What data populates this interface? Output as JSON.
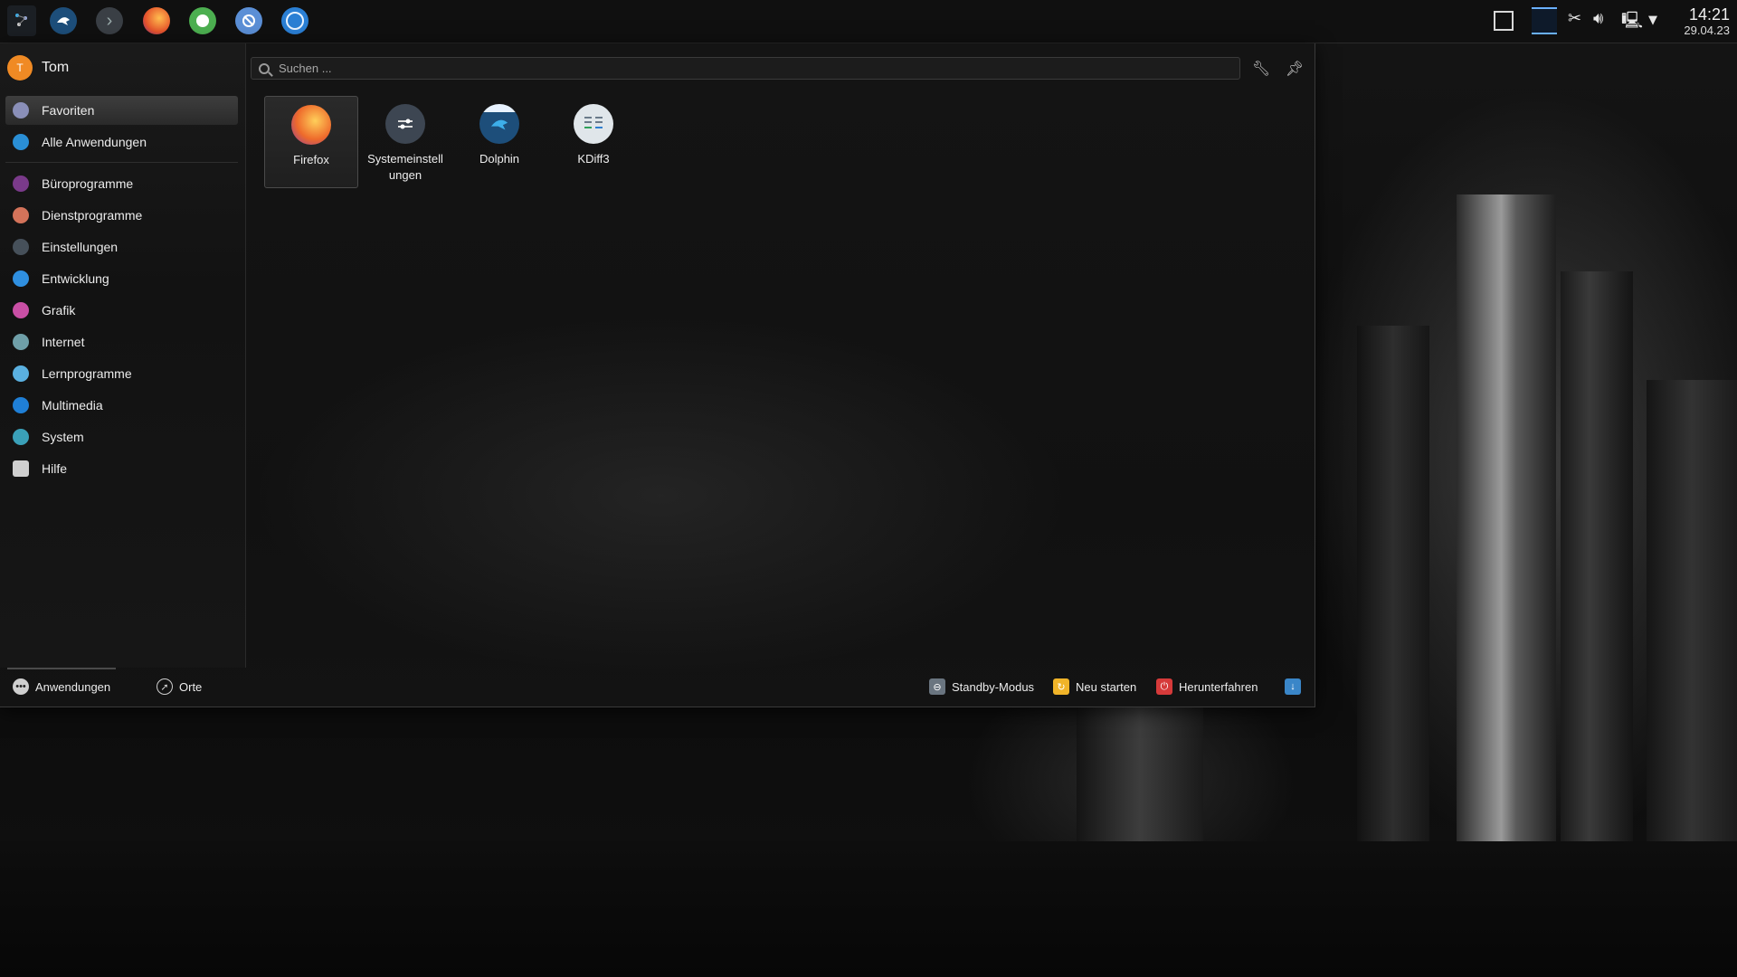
{
  "taskbar": {
    "icons": [
      "kde-launcher-icon",
      "dolphin-icon",
      "chevron-right-icon",
      "firefox-icon",
      "download-icon",
      "krdc-icon",
      "circle-app-icon"
    ],
    "tray": [
      "window-icon",
      "desktop-pager-icon",
      "scissors-icon",
      "volume-icon",
      "network-icon",
      "expand-arrow-icon"
    ],
    "clock": {
      "time": "14:21",
      "date": "29.04.23"
    }
  },
  "user": {
    "initial": "T",
    "name": "Tom"
  },
  "sidebar": {
    "items": [
      {
        "label": "Favoriten",
        "icon": "favorites-icon",
        "color": "#8a8fb8",
        "active": true
      },
      {
        "label": "Alle Anwendungen",
        "icon": "all-apps-icon",
        "color": "#2a8fd6"
      },
      {
        "label": "Büroprogramme",
        "icon": "office-icon",
        "color": "#7a3a8a"
      },
      {
        "label": "Dienstprogramme",
        "icon": "utilities-icon",
        "color": "#d4735a"
      },
      {
        "label": "Einstellungen",
        "icon": "settings-icon",
        "color": "#46505a"
      },
      {
        "label": "Entwicklung",
        "icon": "development-icon",
        "color": "#2f8fe0"
      },
      {
        "label": "Grafik",
        "icon": "graphics-icon",
        "color": "#c94fa5"
      },
      {
        "label": "Internet",
        "icon": "internet-icon",
        "color": "#6f9fa8"
      },
      {
        "label": "Lernprogramme",
        "icon": "education-icon",
        "color": "#5ab0e0"
      },
      {
        "label": "Multimedia",
        "icon": "multimedia-icon",
        "color": "#1f7fd6"
      },
      {
        "label": "System",
        "icon": "system-icon",
        "color": "#3aa0b8"
      },
      {
        "label": "Hilfe",
        "icon": "help-icon",
        "color": "#cfcfcf"
      }
    ]
  },
  "search": {
    "placeholder": "Suchen ..."
  },
  "favorites": [
    {
      "label": "Firefox",
      "icon": "firefox-icon",
      "color": "#e6542b",
      "selected": true
    },
    {
      "label": "Systemeinstell ungen",
      "icon": "system-settings-icon",
      "color": "#3d4652"
    },
    {
      "label": "Dolphin",
      "icon": "dolphin-icon",
      "color": "#1d4e7a"
    },
    {
      "label": "KDiff3",
      "icon": "kdiff3-icon",
      "color": "#e0e6ea"
    }
  ],
  "bottom": {
    "applications": "Anwendungen",
    "places": "Orte",
    "standby": "Standby-Modus",
    "restart": "Neu starten",
    "shutdown": "Herunterfahren"
  }
}
